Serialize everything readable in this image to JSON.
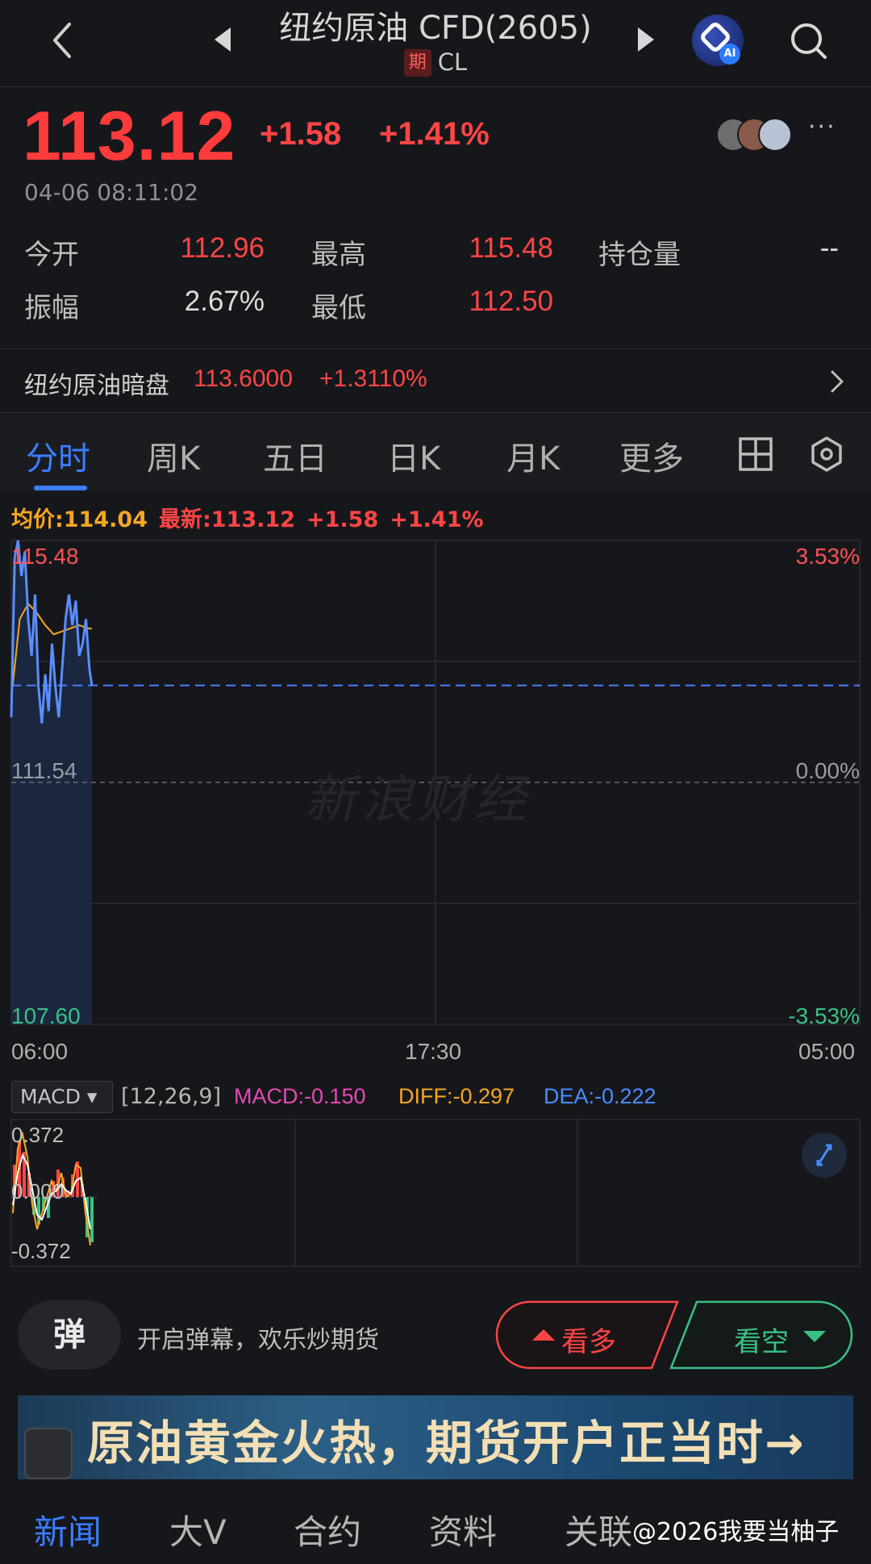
{
  "header": {
    "title": "纽约原油 CFD(2605)",
    "badge": "期",
    "code": "CL",
    "ai_label": "AI"
  },
  "quote": {
    "price": "113.12",
    "change": "+1.58",
    "change_pct": "+1.41%",
    "time": "04-06 08:11:02",
    "more": "···",
    "stats": {
      "open_label": "今开",
      "open_value": "112.96",
      "high_label": "最高",
      "high_value": "115.48",
      "oi_label": "持仓量",
      "oi_value": "--",
      "amp_label": "振幅",
      "amp_value": "2.67%",
      "low_label": "最低",
      "low_value": "112.50"
    }
  },
  "dark_pool": {
    "label": "纽约原油暗盘",
    "price": "113.6000",
    "change_pct": "+1.3110%"
  },
  "tabs": [
    "分时",
    "周K",
    "五日",
    "日K",
    "月K",
    "更多"
  ],
  "legend": {
    "avg": "均价:114.04",
    "last": "最新:113.12",
    "change": "+1.58",
    "pct": "+1.41%"
  },
  "chart": {
    "y_top": "115.48",
    "y_mid": "111.54",
    "y_bot": "107.60",
    "pct_top": "3.53%",
    "pct_mid": "0.00%",
    "pct_bot": "-3.53%",
    "x_start": "06:00",
    "x_mid": "17:30",
    "x_end": "05:00",
    "watermark": "新浪财经"
  },
  "chart_data": {
    "type": "line",
    "ylim": [
      107.6,
      115.48
    ],
    "xlim": [
      0,
      100
    ],
    "prev_close": 111.54,
    "last_price": 113.12,
    "series": [
      {
        "x": [
          0,
          0.4,
          0.8,
          1.2,
          1.6,
          2.0,
          2.4,
          2.8,
          3.2,
          3.6,
          4.0,
          4.4,
          4.8,
          5.2,
          5.6,
          6.0,
          6.4,
          6.8,
          7.2,
          7.6,
          8.0,
          8.4,
          8.8,
          9.2,
          9.5
        ],
        "values": [
          112.6,
          115.2,
          115.48,
          114.9,
          115.3,
          114.2,
          113.6,
          114.6,
          113.1,
          112.5,
          113.3,
          112.7,
          113.8,
          113.1,
          112.6,
          113.4,
          114.2,
          114.6,
          114.1,
          114.5,
          113.6,
          113.8,
          114.2,
          113.4,
          113.12
        ]
      },
      {
        "x": [
          0,
          1,
          2,
          3,
          4,
          5,
          6,
          7,
          8,
          9,
          9.5
        ],
        "values": [
          112.9,
          114.2,
          114.45,
          114.3,
          114.1,
          113.95,
          114.0,
          114.05,
          114.1,
          114.05,
          114.04
        ]
      }
    ]
  },
  "macd": {
    "selector": "MACD ▾",
    "params": "[12,26,9]",
    "macd": "MACD:-0.150",
    "diff": "DIFF:-0.297",
    "dea": "DEA:-0.222",
    "y_top": "0.372",
    "y_mid": "0.000",
    "y_bot": "-0.372"
  },
  "actions": {
    "danmu_btn": "弹",
    "danmu_text": "开启弹幕，欢乐炒期货",
    "bull": "看多",
    "bear": "看空"
  },
  "banner": {
    "text": "原油黄金火热，期货开户正当时→"
  },
  "bottom_tabs": [
    "新闻",
    "大V",
    "合约",
    "资料",
    "关联"
  ],
  "watermark_user": "@2026我要当柚子",
  "colors": {
    "up": "#ff4545",
    "down": "#39c184",
    "accent": "#3b7dff",
    "avg": "#f5a623"
  }
}
